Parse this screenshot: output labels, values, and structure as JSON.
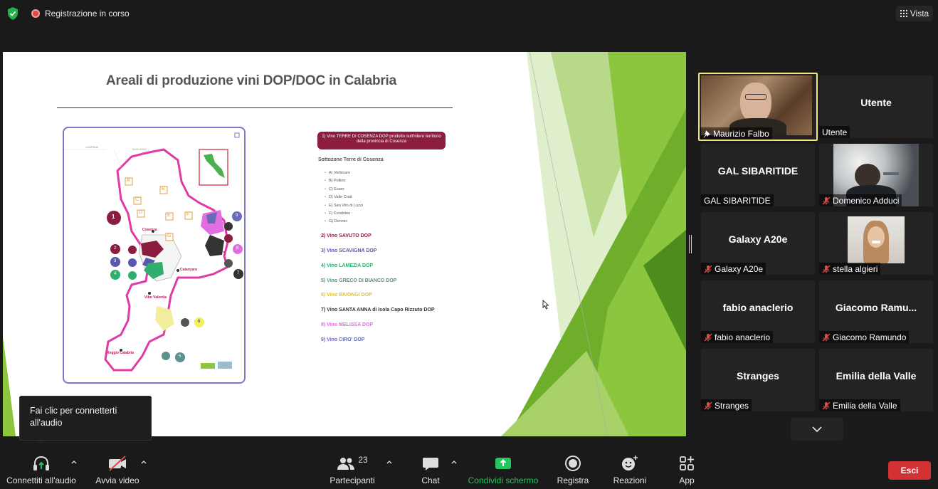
{
  "topbar": {
    "recording_text": "Registrazione in corso",
    "view_label": "Vista",
    "shield_icon": "shield-check-icon",
    "shield_color": "#22b14c"
  },
  "slide": {
    "title": "Areali di produzione vini DOP/DOC in Calabria",
    "legend_box": "1) Vino TERRE DI COSENZA DOP prodotto sull'intero territorio della provincia di Cosenza",
    "subzone_title": "Sottozone Terre di Cosenza",
    "subzones": [
      "A) Verbicaro",
      "B) Pollino",
      "C) Esaro",
      "D) Valle Crati",
      "E) San Vito di Luzzi",
      "F) Condoleo",
      "G) Donnici"
    ],
    "wines": [
      {
        "label": "2) Vino SAVUTO DOP",
        "color": "#8b1e3f"
      },
      {
        "label": "3) Vino SCAVIGNA DOP",
        "color": "#5a57b0"
      },
      {
        "label": "4) Vino LAMEZIA DOP",
        "color": "#2fae6e"
      },
      {
        "label": "5) Vino GRECO DI BIANCO DOP",
        "color": "#5e8f8f"
      },
      {
        "label": "6) Vino BIVONGI DOP",
        "color": "#e0c33a"
      },
      {
        "label": "7) Vino SANTA ANNA di Isola Capo Rizzuto DOP",
        "color": "#333333"
      },
      {
        "label": "8) Vino MELISSA DOP",
        "color": "#e06ee0"
      },
      {
        "label": "9) Vino CIRO' DOP",
        "color": "#6a6ab8"
      }
    ],
    "map_labels": {
      "cosenza": "Cosenza",
      "catanzaro": "Catanzaro",
      "vibo": "Vibo Valentia",
      "reggio": "Reggio Calabria",
      "crotone": "Crotone",
      "campania": "CAMPANIA",
      "basilicata": "BASILICATA"
    },
    "map_letters": [
      "A",
      "B",
      "C",
      "D",
      "E",
      "F",
      "G"
    ],
    "map_numbers": [
      "1",
      "2",
      "3",
      "4",
      "5",
      "6",
      "7",
      "8",
      "9"
    ]
  },
  "participants": [
    {
      "name": "Maurizio Falbo",
      "big": "",
      "video": true,
      "muted": false,
      "pinned": true,
      "active": true
    },
    {
      "name": "Utente",
      "big": "Utente",
      "video": false,
      "muted": false,
      "pinned": false,
      "active": false
    },
    {
      "name": "GAL SIBARITIDE",
      "big": "GAL SIBARITIDE",
      "video": false,
      "muted": false,
      "pinned": false,
      "active": false
    },
    {
      "name": "Domenico Adduci",
      "big": "",
      "video": true,
      "muted": true,
      "pinned": false,
      "active": false
    },
    {
      "name": "Galaxy A20e",
      "big": "Galaxy A20e",
      "video": false,
      "muted": true,
      "pinned": false,
      "active": false
    },
    {
      "name": "stella algieri",
      "big": "",
      "video": true,
      "muted": true,
      "pinned": false,
      "active": false
    },
    {
      "name": "fabio anaclerio",
      "big": "fabio anaclerio",
      "video": false,
      "muted": true,
      "pinned": false,
      "active": false
    },
    {
      "name": "Giacomo Ramundo",
      "big": "Giacomo  Ramu...",
      "video": false,
      "muted": true,
      "pinned": false,
      "active": false
    },
    {
      "name": "Stranges",
      "big": "Stranges",
      "video": false,
      "muted": true,
      "pinned": false,
      "active": false
    },
    {
      "name": "Emilia della Valle",
      "big": "Emilia della Valle",
      "video": false,
      "muted": true,
      "pinned": false,
      "active": false
    }
  ],
  "tooltip": {
    "text": "Fai clic per connetterti all'audio"
  },
  "toolbar": {
    "audio": "Connettiti all'audio",
    "video": "Avvia video",
    "participants": "Partecipanti",
    "participants_count": "23",
    "chat": "Chat",
    "share": "Condividi schermo",
    "record": "Registra",
    "reactions": "Reazioni",
    "apps": "App",
    "leave": "Esci",
    "share_color": "#22c55e",
    "leave_color": "#d33234"
  }
}
